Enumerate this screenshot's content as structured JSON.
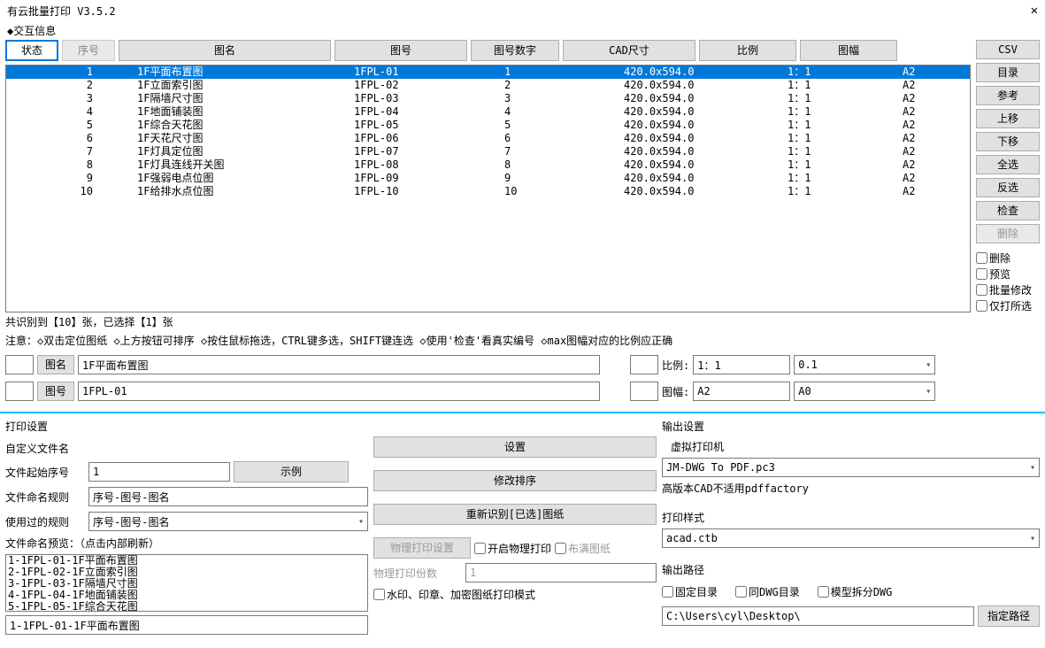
{
  "window": {
    "title": "有云批量打印 V3.5.2"
  },
  "section_header": "◆交互信息",
  "table_headers": {
    "status": "状态",
    "seq": "序号",
    "name": "图名",
    "num": "图号",
    "digit": "图号数字",
    "cad": "CAD尺寸",
    "ratio": "比例",
    "format": "图幅"
  },
  "rows": [
    {
      "seq": "1",
      "name": "1F平面布置图",
      "num": "1FPL-01",
      "digit": "1",
      "cad": "420.0x594.0",
      "ratio": "1：1",
      "fmt": "A2",
      "sel": true
    },
    {
      "seq": "2",
      "name": "1F立面索引图",
      "num": "1FPL-02",
      "digit": "2",
      "cad": "420.0x594.0",
      "ratio": "1：1",
      "fmt": "A2"
    },
    {
      "seq": "3",
      "name": "1F隔墙尺寸图",
      "num": "1FPL-03",
      "digit": "3",
      "cad": "420.0x594.0",
      "ratio": "1：1",
      "fmt": "A2"
    },
    {
      "seq": "4",
      "name": "1F地面铺装图",
      "num": "1FPL-04",
      "digit": "4",
      "cad": "420.0x594.0",
      "ratio": "1：1",
      "fmt": "A2"
    },
    {
      "seq": "5",
      "name": "1F综合天花图",
      "num": "1FPL-05",
      "digit": "5",
      "cad": "420.0x594.0",
      "ratio": "1：1",
      "fmt": "A2"
    },
    {
      "seq": "6",
      "name": "1F天花尺寸图",
      "num": "1FPL-06",
      "digit": "6",
      "cad": "420.0x594.0",
      "ratio": "1：1",
      "fmt": "A2"
    },
    {
      "seq": "7",
      "name": "1F灯具定位图",
      "num": "1FPL-07",
      "digit": "7",
      "cad": "420.0x594.0",
      "ratio": "1：1",
      "fmt": "A2"
    },
    {
      "seq": "8",
      "name": "1F灯具连线开关图",
      "num": "1FPL-08",
      "digit": "8",
      "cad": "420.0x594.0",
      "ratio": "1：1",
      "fmt": "A2"
    },
    {
      "seq": "9",
      "name": "1F强弱电点位图",
      "num": "1FPL-09",
      "digit": "9",
      "cad": "420.0x594.0",
      "ratio": "1：1",
      "fmt": "A2"
    },
    {
      "seq": "10",
      "name": "1F给排水点位图",
      "num": "1FPL-10",
      "digit": "10",
      "cad": "420.0x594.0",
      "ratio": "1：1",
      "fmt": "A2"
    }
  ],
  "side_buttons": {
    "csv": "CSV",
    "catalog": "目录",
    "ref": "参考",
    "up": "上移",
    "down": "下移",
    "all": "全选",
    "inv": "反选",
    "check": "检查",
    "del": "删除"
  },
  "right_checks": {
    "del": "删除",
    "preview": "预览",
    "batch": "批量修改",
    "only": "仅打所选"
  },
  "status": "共识别到【10】张，已选择【1】张",
  "note": "注意：◇双击定位图纸 ◇上方按钮可排序 ◇按住鼠标拖选，CTRL键多选，SHIFT键连选 ◇使用'检查'看真实编号 ◇max图幅对应的比例应正确",
  "form": {
    "name_lbl": "图名",
    "name_val": "1F平面布置图",
    "num_lbl": "图号",
    "num_val": "1FPL-01",
    "ratio_lbl": "比例:",
    "ratio_a": "1：1",
    "ratio_b": "0.1",
    "fmt_lbl": "图幅:",
    "fmt_a": "A2",
    "fmt_b": "A0"
  },
  "print": {
    "sec": "打印设置",
    "custom": "自定义文件名",
    "start_lbl": "文件起始序号",
    "start_val": "1",
    "sample": "示例",
    "rule_lbl": "文件命名规则",
    "rule_val": "序号-图号-图名",
    "used_lbl": "使用过的规则",
    "used_val": "序号-图号-图名",
    "preview_lbl": "文件命名预览：（点击内部刷新）",
    "preview_list": [
      "1-1FPL-01-1F平面布置图",
      "2-1FPL-02-1F立面索引图",
      "3-1FPL-03-1F隔墙尺寸图",
      "4-1FPL-04-1F地面铺装图",
      "5-1FPL-05-1F综合天花图"
    ],
    "selected": "1-1FPL-01-1F平面布置图"
  },
  "mid": {
    "settings": "设置",
    "reorder": "修改排序",
    "reident": "重新识别[已选]图纸",
    "phys_set": "物理打印设置",
    "phys_on": "开启物理打印",
    "fill": "布满图纸",
    "copies_lbl": "物理打印份数",
    "copies_val": "1",
    "wm": "水印、印章、加密图纸打印模式"
  },
  "out": {
    "sec": "输出设置",
    "vp": "虚拟打印机",
    "printer": "JM-DWG To PDF.pc3",
    "warn": "高版本CAD不适用pdffactory",
    "style_lbl": "打印样式",
    "style": "acad.ctb",
    "path_lbl": "输出路径",
    "fix": "固定目录",
    "same": "同DWG目录",
    "split": "模型拆分DWG",
    "path": "C:\\Users\\cyl\\Desktop\\",
    "browse": "指定路径"
  }
}
